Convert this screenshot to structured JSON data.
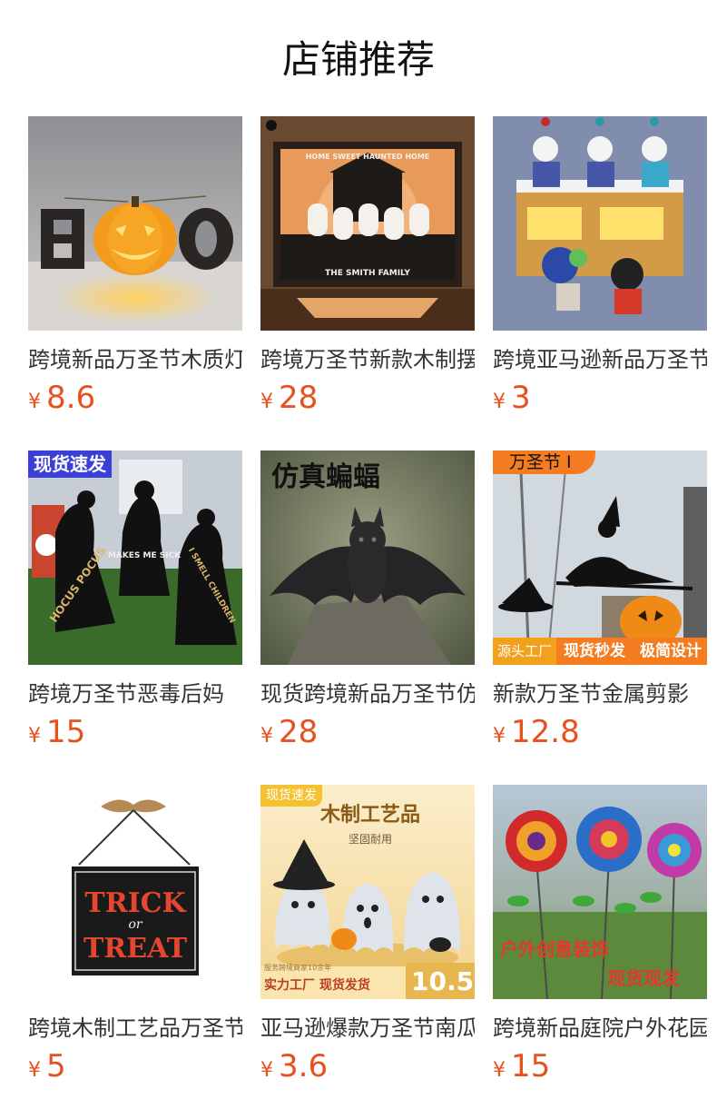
{
  "page": {
    "title": "店铺推荐"
  },
  "currency_symbol": "¥",
  "products": [
    {
      "name": "跨境新品万圣节木质灯",
      "price": "8.6",
      "image": "boo-pumpkin-lamp",
      "badges": []
    },
    {
      "name": "跨境万圣节新款木制摆件",
      "price": "28",
      "image": "haunted-home-frame",
      "badges": [],
      "image_text": {
        "top": "HOME SWEET HAUNTED HOME",
        "bottom": "THE SMITH FAMILY"
      }
    },
    {
      "name": "跨境亚马逊新品万圣节",
      "price": "3",
      "image": "acrylic-keychains",
      "badges": []
    },
    {
      "name": "跨境万圣节恶毒后妈",
      "price": "15",
      "image": "witch-silhouettes",
      "badges": [
        "现货速发"
      ],
      "image_text": {
        "a": "HOCUS POCUS",
        "b": "MAKES ME SICK",
        "c": "I SMELL CHILDREN"
      }
    },
    {
      "name": "现货跨境新品万圣节仿真蝙蝠",
      "price": "28",
      "image": "plush-bat",
      "badges": [
        "仿真蝙蝠"
      ]
    },
    {
      "name": "新款万圣节金属剪影",
      "price": "12.8",
      "image": "witch-broom-stake",
      "badges": [
        "万圣节 I",
        "源头工厂",
        "现货秒发",
        "极简设计"
      ]
    },
    {
      "name": "跨境木制工艺品万圣节",
      "price": "5",
      "image": "trick-or-treat-sign",
      "badges": [],
      "image_text": {
        "line1": "TRICK",
        "line2": "or",
        "line3": "TREAT"
      }
    },
    {
      "name": "亚马逊爆款万圣节南瓜",
      "price": "3.6",
      "image": "wooden-ghosts",
      "badges": [
        "现货速发",
        "木制工艺品",
        "坚固耐用",
        "服务跨境商家10余年",
        "实力工厂  现货发货",
        "10.5"
      ]
    },
    {
      "name": "跨境新品庭院户外花园插",
      "price": "15",
      "image": "metal-flower-stakes",
      "badges": [
        "户外创意装饰",
        "现货现发"
      ]
    }
  ]
}
